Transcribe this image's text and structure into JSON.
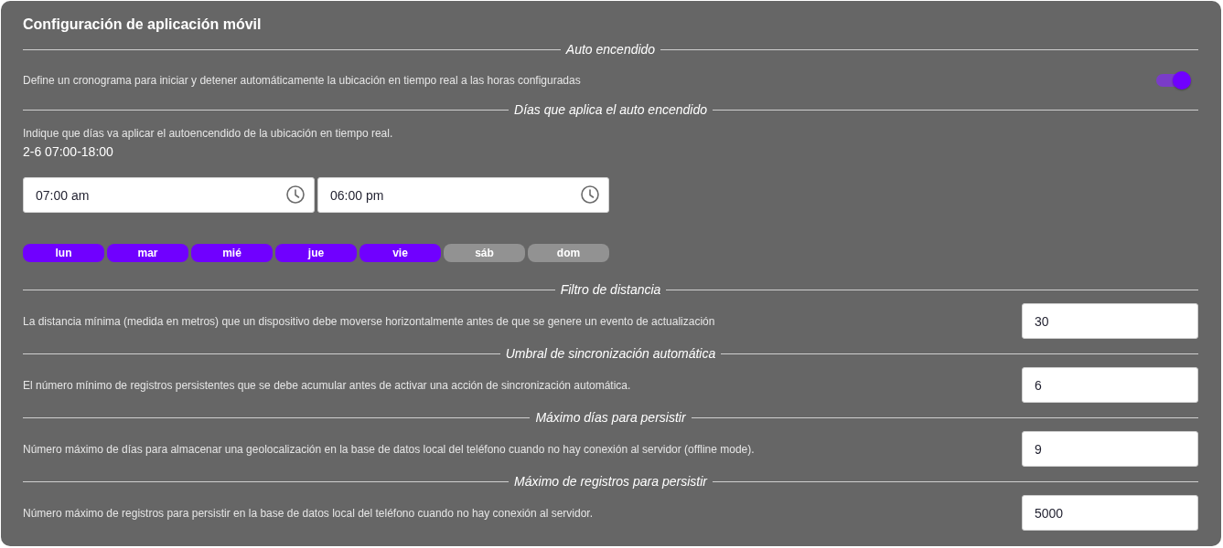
{
  "title": "Configuración de aplicación móvil",
  "sections": [
    {
      "kind": "toggle",
      "heading": "Auto encendido",
      "description": "Define un cronograma para iniciar y detener automáticamente la ubicación en tiempo real a las horas configuradas",
      "on": true
    },
    {
      "kind": "schedule",
      "heading": "Días que aplica el auto encendido",
      "description": "Indique que días va aplicar el autoencendido de la ubicación en tiempo real.",
      "summary": "2-6 07:00-18:00",
      "times": [
        {
          "value": "07:00 am"
        },
        {
          "value": "06:00 pm"
        }
      ],
      "days": [
        {
          "label": "lun",
          "selected": true
        },
        {
          "label": "mar",
          "selected": true
        },
        {
          "label": "mié",
          "selected": true
        },
        {
          "label": "jue",
          "selected": true
        },
        {
          "label": "vie",
          "selected": true
        },
        {
          "label": "sáb",
          "selected": false
        },
        {
          "label": "dom",
          "selected": false
        }
      ]
    },
    {
      "kind": "number",
      "heading": "Filtro de distancia",
      "description": "La distancia mínima (medida en metros) que un dispositivo debe moverse horizontalmente antes de que se genere un evento de actualización",
      "value": "30"
    },
    {
      "kind": "number",
      "heading": "Umbral de sincronización automática",
      "description": "El número mínimo de registros persistentes que se debe acumular antes de activar una acción de sincronización automática.",
      "value": "6"
    },
    {
      "kind": "number",
      "heading": "Máximo días para persistir",
      "description": "Número máximo de días para almacenar una geolocalización en la base de datos local del teléfono cuando no hay conexión al servidor (offline mode).",
      "value": "9"
    },
    {
      "kind": "number",
      "heading": "Máximo de registros para persistir",
      "description": "Número máximo de registros para persistir en la base de datos local del teléfono cuando no hay conexión al servidor.",
      "value": "5000"
    }
  ]
}
